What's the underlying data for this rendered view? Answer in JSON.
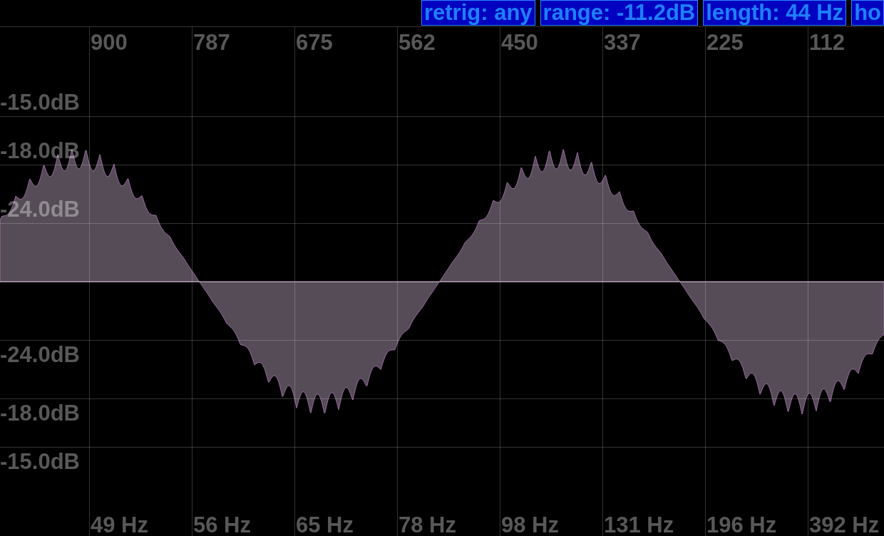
{
  "toolbar": {
    "buttons": [
      {
        "label": "retrig: any"
      },
      {
        "label": "range: -11.2dB"
      },
      {
        "label": "length: 44 Hz"
      },
      {
        "label": "ho"
      }
    ]
  },
  "scope": {
    "top_scale": [
      "900",
      "787",
      "675",
      "562",
      "450",
      "337",
      "225",
      "112"
    ],
    "level_labels": {
      "upper": [
        "-15.0dB",
        "-18.0dB",
        "-24.0dB"
      ],
      "lower": [
        "-24.0dB",
        "-18.0dB",
        "-15.0dB"
      ]
    },
    "frequency_scale": [
      "49 Hz",
      "56 Hz",
      "65 Hz",
      "78 Hz",
      "98 Hz",
      "131 Hz",
      "196 Hz",
      "392 Hz"
    ]
  }
}
